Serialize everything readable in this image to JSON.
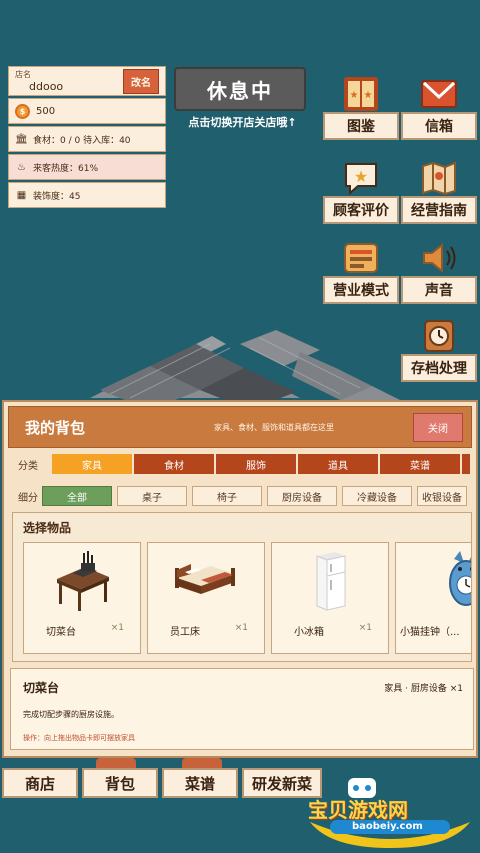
{
  "shop": {
    "name_label": "店名",
    "name_value": "ddooo",
    "rename_label": "改名",
    "coins": "500",
    "ingredients": "食材：0 / 0  待入库：40",
    "popularity": "来客热度：61%",
    "decoration": "装饰度：45"
  },
  "status": {
    "label": "休息中",
    "hint": "点击切换开店关店哦↑"
  },
  "side_menu": [
    {
      "label": "图鉴",
      "icon": "book-icon"
    },
    {
      "label": "信箱",
      "icon": "mail-icon"
    },
    {
      "label": "顾客评价",
      "icon": "star-review-icon"
    },
    {
      "label": "经营指南",
      "icon": "map-guide-icon"
    },
    {
      "label": "营业模式",
      "icon": "mode-icon"
    },
    {
      "label": "声音",
      "icon": "speaker-icon"
    },
    {
      "label": "存档处理",
      "icon": "save-clock-icon"
    }
  ],
  "bag": {
    "title": "我的背包",
    "subtitle": "家具、食材、服饰和道具都在这里",
    "close_label": "关闭",
    "category_label": "分类",
    "categories": [
      "家具",
      "食材",
      "服饰",
      "道具",
      "菜谱"
    ],
    "subcategory_label": "细分",
    "subcategories": [
      "全部",
      "桌子",
      "椅子",
      "厨房设备",
      "冷藏设备",
      "收银设备"
    ],
    "select_label": "选择物品",
    "items": [
      {
        "name": "切菜台",
        "count": "×1"
      },
      {
        "name": "员工床",
        "count": "×1"
      },
      {
        "name": "小冰箱",
        "count": "×1"
      },
      {
        "name": "小猫挂钟（...",
        "count": ""
      }
    ],
    "detail": {
      "name": "切菜台",
      "category": "家具 · 厨房设备   ×1",
      "description": "完成切配步骤的厨房设施。",
      "hint": "操作：向上拖出物品卡即可摆放家具"
    }
  },
  "bottom_bar": [
    "商店",
    "背包",
    "菜谱",
    "研发新菜"
  ],
  "watermark": {
    "title": "宝贝游戏网",
    "url": "baobeiy.com"
  },
  "colors": {
    "background": "#1f5f6e",
    "panel": "#fbeedd",
    "accent": "#c97a3f",
    "active_tab": "#f4a124",
    "tab": "#b5461c"
  }
}
